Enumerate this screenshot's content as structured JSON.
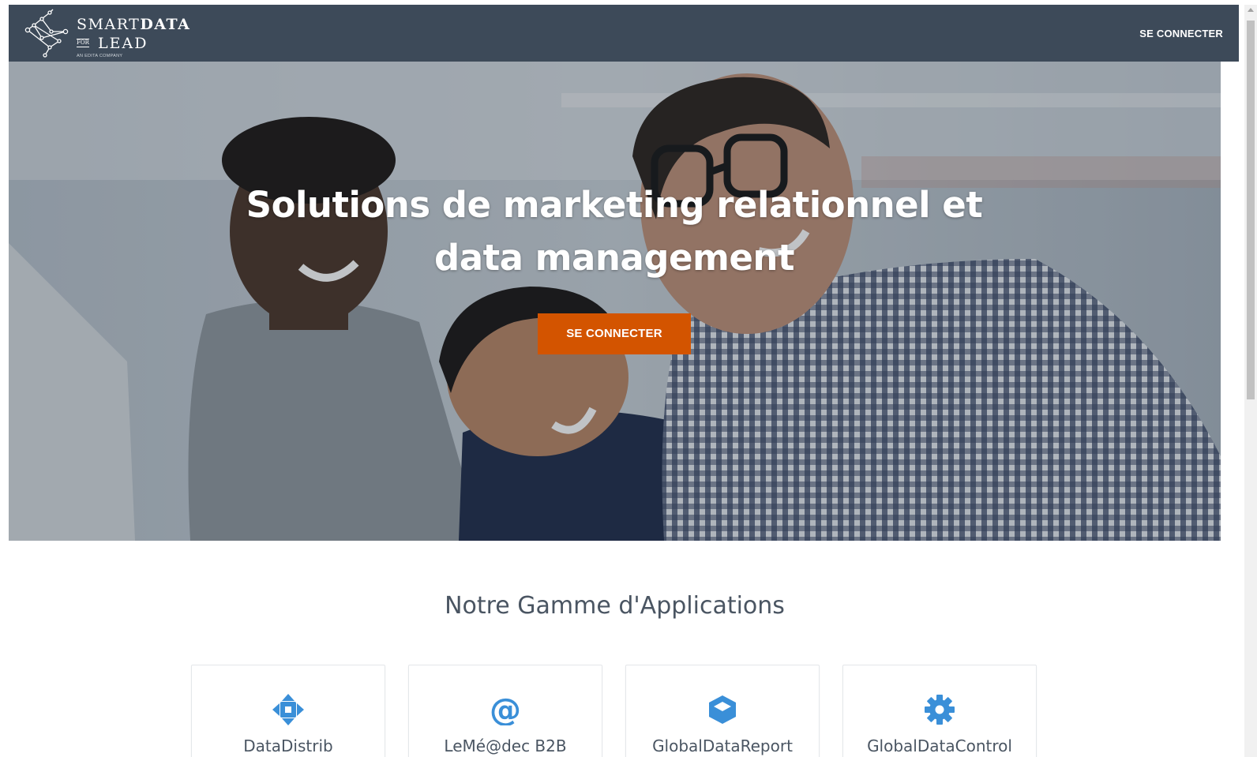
{
  "header": {
    "logo": {
      "brand_line1_light": "SMART",
      "brand_line1_bold": "DATA",
      "brand_for": "FOR",
      "brand_line2": "LEAD",
      "tagline": "AN EDITA COMPANY"
    },
    "login_label": "SE CONNECTER"
  },
  "hero": {
    "title": "Solutions de marketing relationnel et data management",
    "cta_label": "SE CONNECTER"
  },
  "apps": {
    "title": "Notre Gamme d'Applications",
    "cards": [
      {
        "label": "DataDistrib",
        "icon": "arrows-move-icon"
      },
      {
        "label": "LeMé@dec B2B",
        "icon": "at-sign-icon"
      },
      {
        "label": "GlobalDataReport",
        "icon": "cube-icon"
      },
      {
        "label": "GlobalDataControl",
        "icon": "gear-icon"
      }
    ]
  },
  "colors": {
    "navbar": "#3d4a59",
    "accent": "#d35400",
    "icon_blue": "#3a8fd8",
    "text_dark": "#4a5562"
  }
}
